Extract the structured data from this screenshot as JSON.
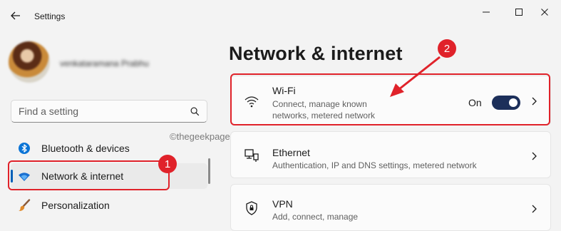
{
  "window": {
    "title": "Settings",
    "icons": {
      "back": "back-arrow-icon",
      "minimize": "minimize-icon",
      "maximize": "maximize-icon",
      "close": "close-icon"
    }
  },
  "profile": {
    "name": "venkataramana Prabhu"
  },
  "search": {
    "placeholder": "Find a setting",
    "value": "",
    "icon": "search-icon"
  },
  "sidebar": {
    "items": [
      {
        "label": "Bluetooth & devices",
        "icon": "bluetooth-icon",
        "selected": false
      },
      {
        "label": "Network & internet",
        "icon": "wifi-icon",
        "selected": true
      },
      {
        "label": "Personalization",
        "icon": "paintbrush-icon",
        "selected": false
      }
    ]
  },
  "main": {
    "title": "Network & internet",
    "cards": [
      {
        "title": "Wi-Fi",
        "subtitle_line1": "Connect, manage known",
        "subtitle_line2": "networks, metered network",
        "icon": "wifi-icon",
        "toggle_label": "On",
        "toggle_on": true
      },
      {
        "title": "Ethernet",
        "subtitle": "Authentication, IP and DNS settings, metered network",
        "icon": "ethernet-icon"
      },
      {
        "title": "VPN",
        "subtitle": "Add, connect, manage",
        "icon": "shield-icon"
      }
    ]
  },
  "annotations": {
    "badge1": "1",
    "badge2": "2",
    "watermark": "©thegeekpage.com",
    "color": "#e0222a"
  },
  "colors": {
    "accent": "#005fb8",
    "toggle": "#1c2f5a",
    "annotation": "#e0222a"
  }
}
